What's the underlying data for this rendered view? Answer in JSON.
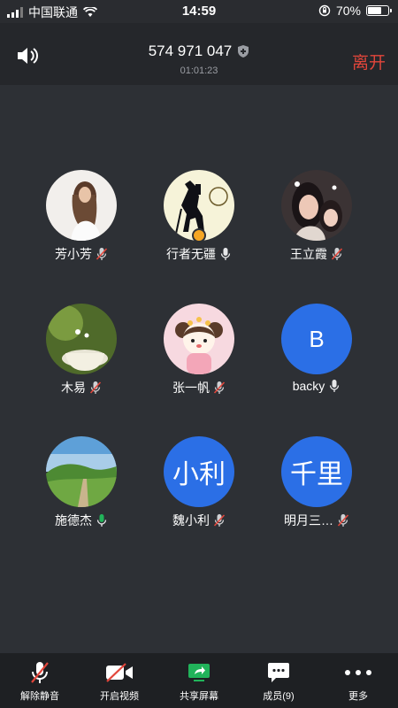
{
  "status_bar": {
    "carrier": "中国联通",
    "time": "14:59",
    "battery": "70%",
    "battery_level": 0.7
  },
  "header": {
    "meeting_id": "574 971 047",
    "duration": "01:01:23",
    "leave_label": "离开"
  },
  "participants": [
    {
      "name": "芳小芳",
      "mic": "muted",
      "avatar": "photo-girl"
    },
    {
      "name": "行者无疆",
      "mic": "on",
      "avatar": "photo-hiker",
      "host": true
    },
    {
      "name": "王立霞",
      "mic": "muted",
      "avatar": "photo-selfie"
    },
    {
      "name": "木易",
      "mic": "muted",
      "avatar": "photo-teacup"
    },
    {
      "name": "张一帆",
      "mic": "muted",
      "avatar": "cartoon-girl"
    },
    {
      "name": "backy",
      "mic": "on",
      "avatar": "letter",
      "letter": "B"
    },
    {
      "name": "施德杰",
      "mic": "on",
      "avatar": "photo-landscape"
    },
    {
      "name": "魏小利",
      "mic": "muted",
      "avatar": "letter",
      "letter": "小利"
    },
    {
      "name": "明月三…",
      "mic": "muted",
      "avatar": "letter",
      "letter": "千里"
    }
  ],
  "toolbar": [
    {
      "label": "解除静音",
      "icon": "mic-off-icon"
    },
    {
      "label": "开启视频",
      "icon": "video-off-icon"
    },
    {
      "label": "共享屏幕",
      "icon": "share-screen-icon"
    },
    {
      "label": "成员(9)",
      "icon": "members-icon"
    },
    {
      "label": "更多",
      "icon": "more-icon"
    }
  ],
  "colors": {
    "leave": "#e2463b",
    "accent": "#2b6fe6",
    "share": "#21b35a"
  }
}
